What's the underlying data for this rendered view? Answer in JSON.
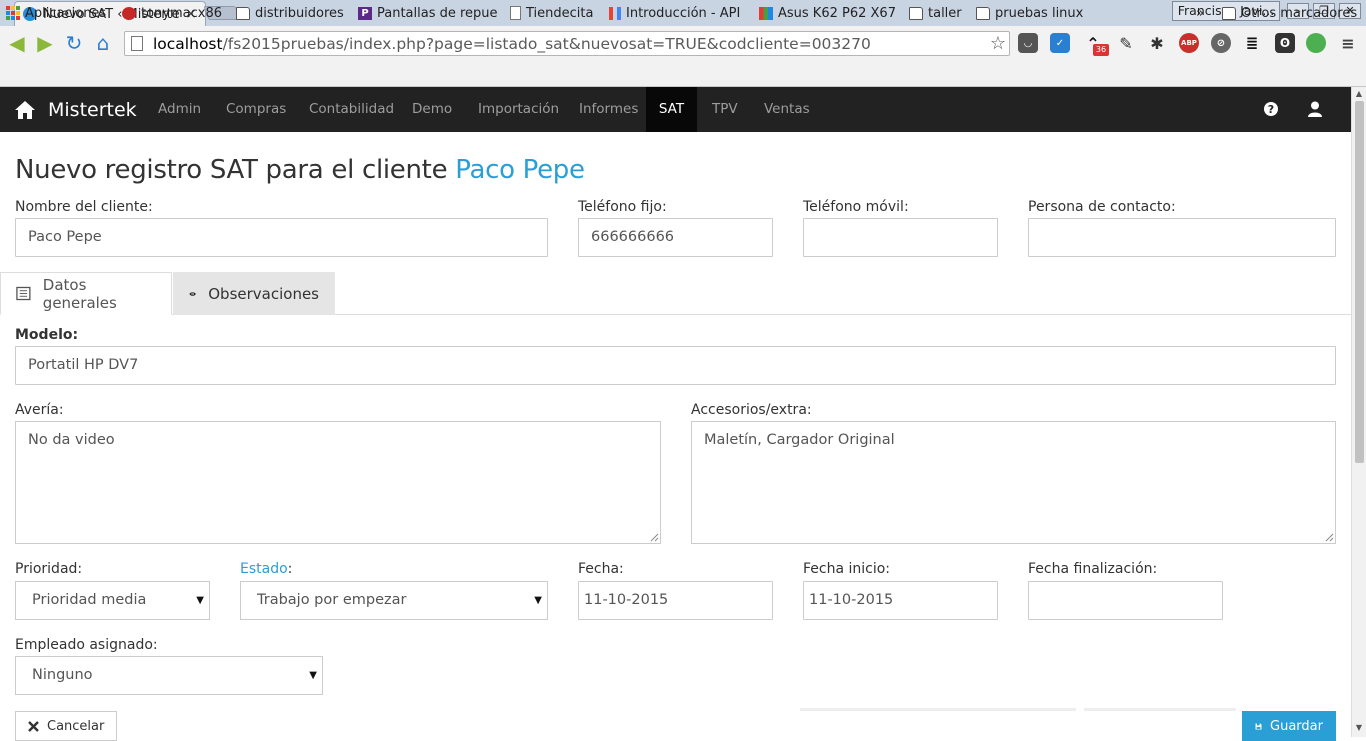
{
  "browser": {
    "tab_title": "Nuevo SAT ‹ Misterte",
    "tab_close": "×",
    "profile_name": "Francisco Javi...",
    "url_host": "localhost",
    "url_path": "/fs2015pruebas/index.php?page=listado_sat&nuevosat=TRUE&codcliente=003270",
    "extension_badge": "36",
    "abp_label": "ABP",
    "bookmarks": [
      {
        "label": "Aplicaciones",
        "icon": "apps-grid-icon"
      },
      {
        "label": "tonymacx86",
        "icon": "apple-icon"
      },
      {
        "label": "distribuidores",
        "icon": "folder-icon"
      },
      {
        "label": "Pantallas de repue",
        "icon": "p-logo-icon"
      },
      {
        "label": "Tiendecita",
        "icon": "page-icon"
      },
      {
        "label": "Introducción - API",
        "icon": "google-api-icon"
      },
      {
        "label": "Asus K62 P62 X67",
        "icon": "tv-icon"
      },
      {
        "label": "taller",
        "icon": "folder-icon"
      },
      {
        "label": "pruebas linux",
        "icon": "folder-icon"
      }
    ],
    "bookmarks_overflow": "»",
    "other_bookmarks": "Otros marcadores"
  },
  "app": {
    "brand": "Mistertek",
    "menu": [
      "Admin",
      "Compras",
      "Contabilidad",
      "Demo",
      "Importación",
      "Informes",
      "SAT",
      "TPV",
      "Ventas"
    ],
    "active_menu": "SAT"
  },
  "page": {
    "title_prefix": "Nuevo registro SAT para el cliente",
    "client_link": "Paco Pepe",
    "fields": {
      "nombre_label": "Nombre del cliente:",
      "nombre_value": "Paco Pepe",
      "tel_fijo_label": "Teléfono fijo:",
      "tel_fijo_value": "666666666",
      "tel_movil_label": "Teléfono móvil:",
      "tel_movil_value": "",
      "contacto_label": "Persona de contacto:",
      "contacto_value": ""
    },
    "tabs": [
      {
        "label": "Datos generales",
        "icon": "list-icon",
        "active": true
      },
      {
        "label": "Observaciones",
        "icon": "eye-icon",
        "active": false
      }
    ],
    "general": {
      "modelo_label": "Modelo:",
      "modelo_value": "Portatil HP DV7",
      "averia_label": "Avería:",
      "averia_value": "No da video",
      "accesorios_label": "Accesorios/extra:",
      "accesorios_value": "Maletín, Cargador Original",
      "prioridad_label": "Prioridad:",
      "prioridad_value": "Prioridad media",
      "estado_label_link": "Estado",
      "estado_label_colon": ":",
      "estado_value": "Trabajo por empezar",
      "fecha_label": "Fecha:",
      "fecha_value": "11-10-2015",
      "fecha_inicio_label": "Fecha inicio:",
      "fecha_inicio_value": "11-10-2015",
      "fecha_fin_label": "Fecha finalización:",
      "fecha_fin_value": "",
      "empleado_label": "Empleado asignado:",
      "empleado_value": "Ninguno"
    },
    "actions": {
      "cancel": "Cancelar",
      "save": "Guardar"
    }
  },
  "colors": {
    "accent": "#2a9fd6",
    "navbar": "#222222",
    "navbar_active": "#080808"
  }
}
